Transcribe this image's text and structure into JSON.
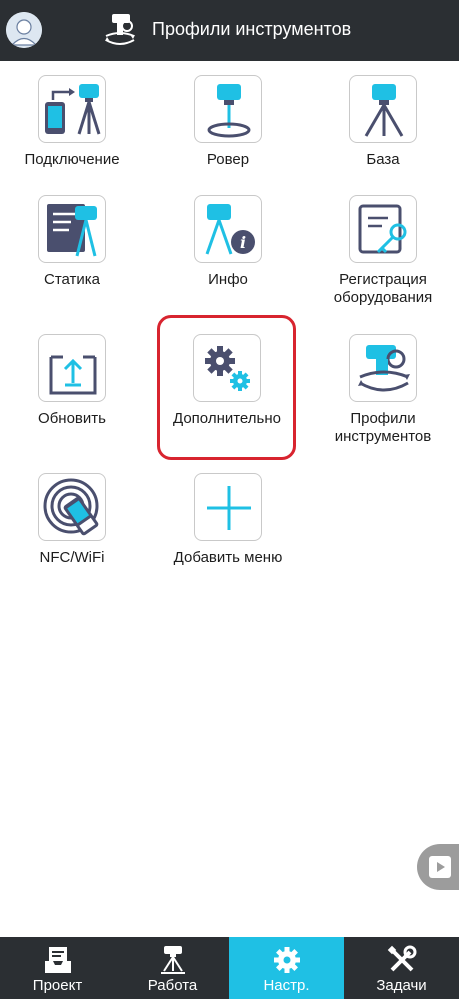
{
  "header": {
    "title": "Профили инструментов",
    "avatar_icon": "user-avatar-icon",
    "title_icon": "instrument-profiles-icon"
  },
  "tiles": [
    {
      "label": "Подключение",
      "icon": "connection-icon"
    },
    {
      "label": "Ровер",
      "icon": "rover-icon"
    },
    {
      "label": "База",
      "icon": "base-icon"
    },
    {
      "label": "Статика",
      "icon": "static-icon"
    },
    {
      "label": "Инфо",
      "icon": "info-icon"
    },
    {
      "label": "Регистрация оборудования",
      "icon": "registration-key-icon"
    },
    {
      "label": "Обновить",
      "icon": "update-icon"
    },
    {
      "label": "Дополнительно",
      "icon": "advanced-settings-icon"
    },
    {
      "label": "Профили инструментов",
      "icon": "instrument-profiles-icon"
    },
    {
      "label": "NFC/WiFi",
      "icon": "nfc-wifi-icon"
    },
    {
      "label": "Добавить меню",
      "icon": "add-menu-icon"
    }
  ],
  "nav": [
    {
      "label": "Проект",
      "icon": "project-icon",
      "active": false
    },
    {
      "label": "Работа",
      "icon": "survey-work-icon",
      "active": false
    },
    {
      "label": "Настр.",
      "icon": "settings-gear-icon",
      "active": true
    },
    {
      "label": "Задачи",
      "icon": "tools-icon",
      "active": false
    }
  ],
  "colors": {
    "header_bg": "#2b2f33",
    "accent": "#1fc0e4",
    "icon_dark": "#4a4f6e",
    "highlight": "#d8242f"
  }
}
